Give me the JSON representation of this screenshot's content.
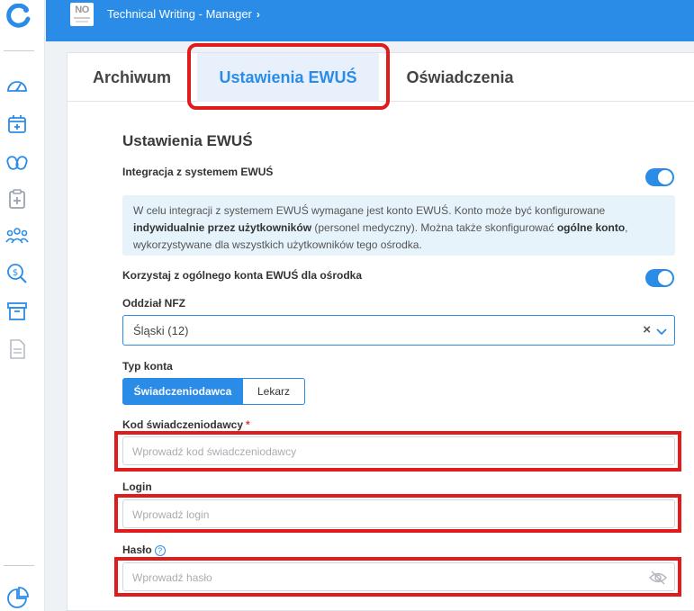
{
  "topbar": {
    "logo_text": "NO",
    "breadcrumb": "Technical Writing - Manager",
    "chevron": "›"
  },
  "sidebar": {
    "icons": [
      "logo-icon",
      "dashboard-gauge-icon",
      "calendar-add-icon",
      "pills-icon",
      "clipboard-add-icon",
      "people-icon",
      "finance-search-icon",
      "archive-box-icon",
      "document-icon",
      "pie-chart-icon"
    ]
  },
  "tabs": [
    {
      "label": "Archiwum",
      "active": false
    },
    {
      "label": "Ustawienia EWUŚ",
      "active": true
    },
    {
      "label": "Oświadczenia",
      "active": false
    }
  ],
  "settings": {
    "title": "Ustawienia EWUŚ",
    "integration_label": "Integracja z systemem EWUŚ",
    "integration_enabled": true,
    "info": {
      "part1": "W celu integracji z systemem EWUŚ wymagane jest konto EWUŚ. Konto może być konfigurowane ",
      "bold1": "indywidualnie przez użytkowników",
      "part2": " (personel medyczny). Można także skonfigurować ",
      "bold2": "ogólne konto",
      "part3": ", wykorzystywane dla wszystkich użytkowników tego ośrodka."
    },
    "shared_account_label": "Korzystaj z ogólnego konta EWUŚ dla ośrodka",
    "shared_account_enabled": true,
    "nfz_label": "Oddział NFZ",
    "nfz_value": "Śląski (12)",
    "clear_symbol": "×",
    "account_type_label": "Typ konta",
    "account_types": [
      "Świadczeniodawca",
      "Lekarz"
    ],
    "account_type_selected": "Świadczeniodawca",
    "provider_code_label": "Kod świadczeniodawcy",
    "required_mark": "*",
    "provider_code_placeholder": "Wprowadź kod świadczeniodawcy",
    "login_label": "Login",
    "login_placeholder": "Wprowadź login",
    "password_label": "Hasło",
    "help_symbol": "?",
    "password_placeholder": "Wprowadź hasło"
  },
  "colors": {
    "accent": "#2b8ce8",
    "highlight": "#e01b1b",
    "info_bg": "#e6f3fa"
  }
}
